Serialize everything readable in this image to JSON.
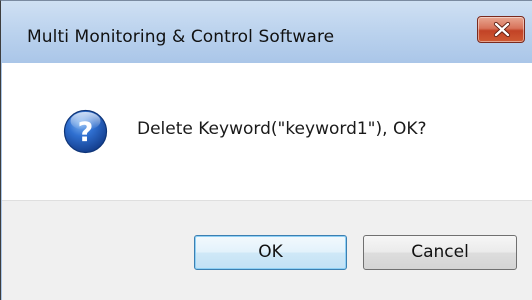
{
  "window": {
    "title": "Multi Monitoring & Control Software"
  },
  "dialog": {
    "icon": "question-icon",
    "message": "Delete Keyword(\"keyword1\"), OK?"
  },
  "buttons": {
    "ok_label": "OK",
    "cancel_label": "Cancel"
  },
  "colors": {
    "titlebar": "#bcd3ee",
    "close_button": "#c24326",
    "question_icon": "#1f58b8",
    "button_area": "#f0f0f0",
    "default_button_border": "#3c7fb1"
  }
}
